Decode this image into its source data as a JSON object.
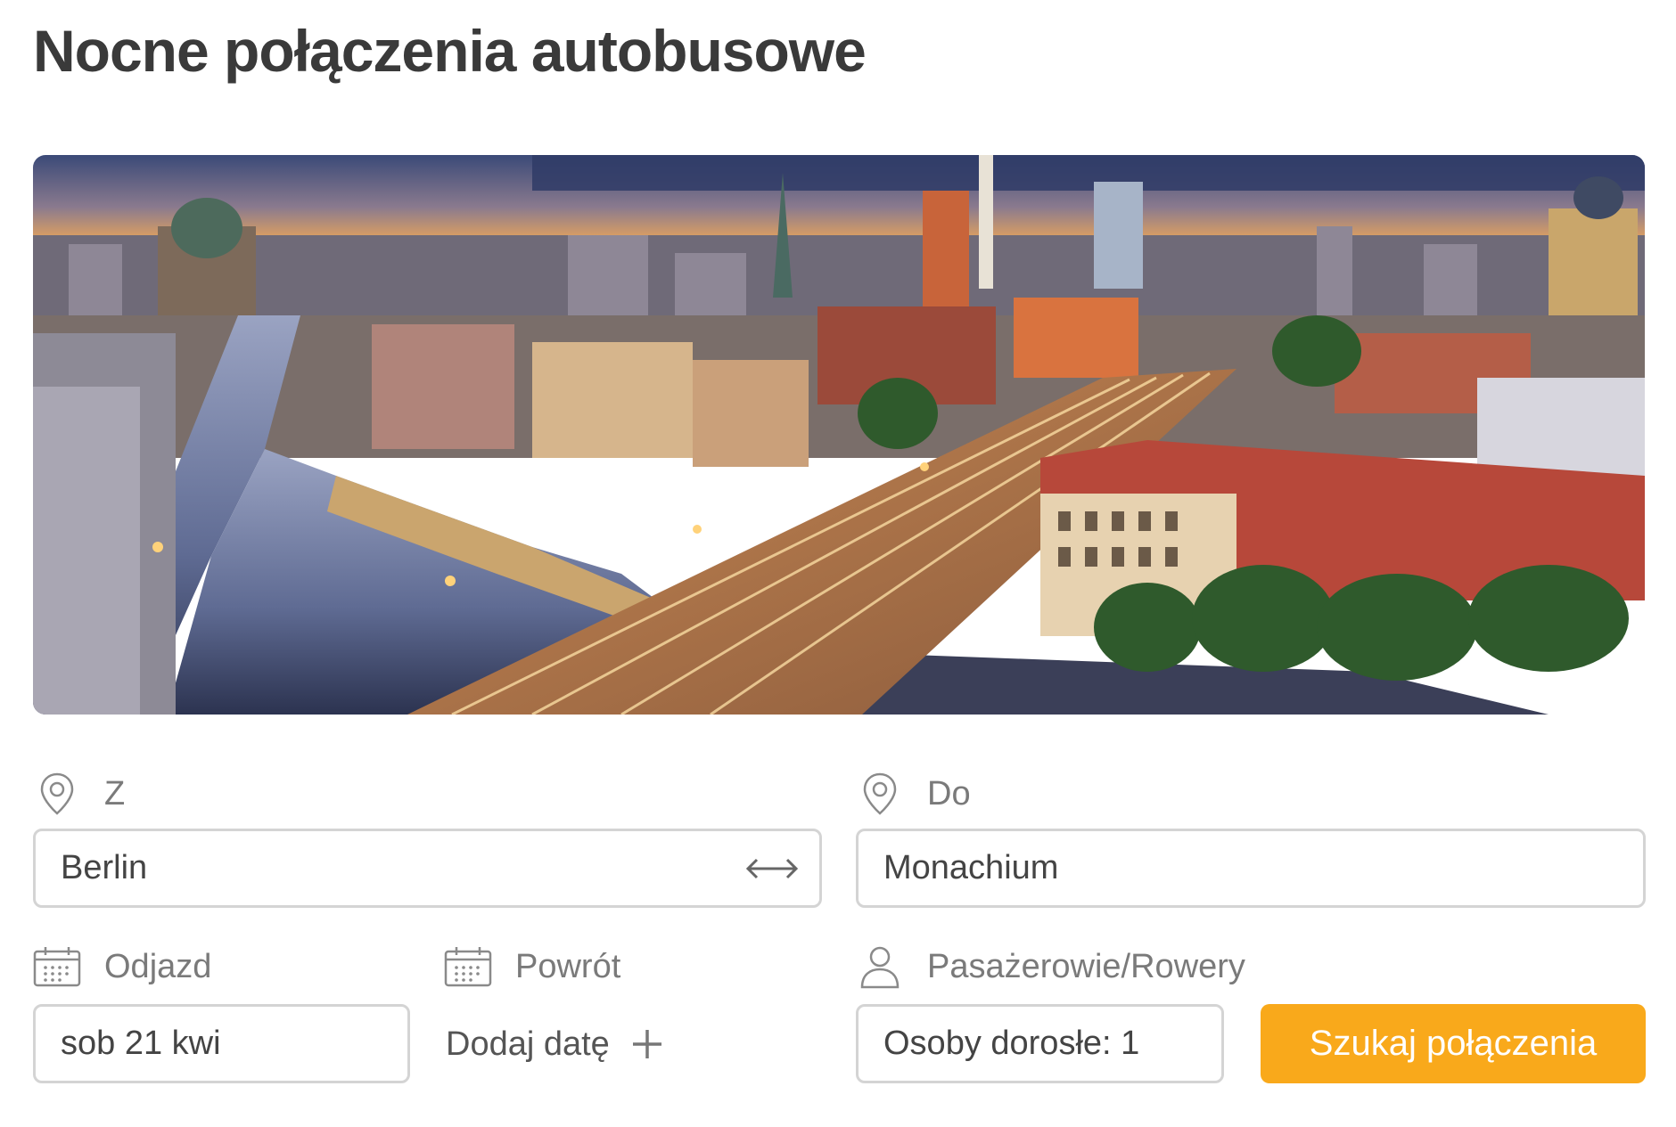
{
  "page": {
    "title": "Nocne połączenia autobusowe"
  },
  "hero": {
    "image_icon": "city-panorama-image"
  },
  "form": {
    "from": {
      "label": "Z",
      "value": "Berlin",
      "icon": "location-pin-icon",
      "swap_icon": "swap-arrows-icon"
    },
    "to": {
      "label": "Do",
      "value": "Monachium",
      "icon": "location-pin-icon"
    },
    "departure": {
      "label": "Odjazd",
      "value": "sob 21 kwi",
      "icon": "calendar-icon"
    },
    "return": {
      "label": "Powrót",
      "add_label": "Dodaj datę",
      "icon": "calendar-icon",
      "add_icon": "plus-icon"
    },
    "passengers": {
      "label": "Pasażerowie/Rowery",
      "value": "Osoby dorosłe: 1",
      "icon": "person-icon"
    },
    "search_button": "Szukaj połączenia"
  },
  "colors": {
    "accent": "#f9a91b",
    "border": "#d4d4d4",
    "label": "#7a7a7a",
    "title": "#3a3a3a"
  }
}
